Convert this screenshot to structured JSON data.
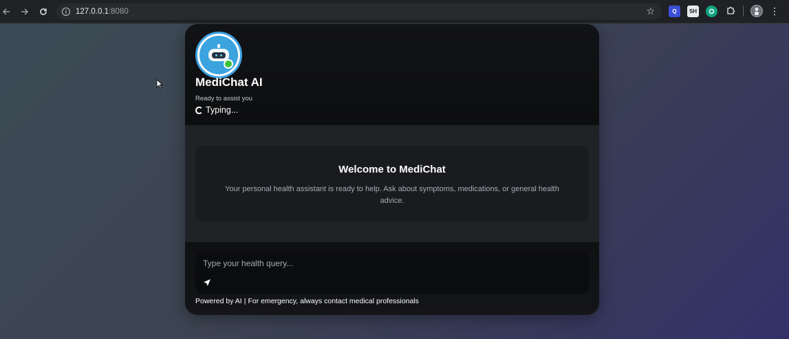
{
  "browser": {
    "url_host": "127.0.0.1",
    "url_port": ":8080",
    "extensions": [
      "Q",
      "SH",
      "G"
    ]
  },
  "header": {
    "bot_name": "MediChat AI",
    "status": "Ready to assist you",
    "typing": "Typing..."
  },
  "welcome": {
    "title": "Welcome to MediChat",
    "text": "Your personal health assistant is ready to help. Ask about symptoms, medications, or general health advice."
  },
  "composer": {
    "placeholder": "Type your health query..."
  },
  "footer": {
    "powered_by": "Powered by AI",
    "separator": "|",
    "notice": "For emergency, always contact medical professionals"
  },
  "colors": {
    "online": "#3cc13b",
    "avatar_ring": "#3ba0e0"
  }
}
